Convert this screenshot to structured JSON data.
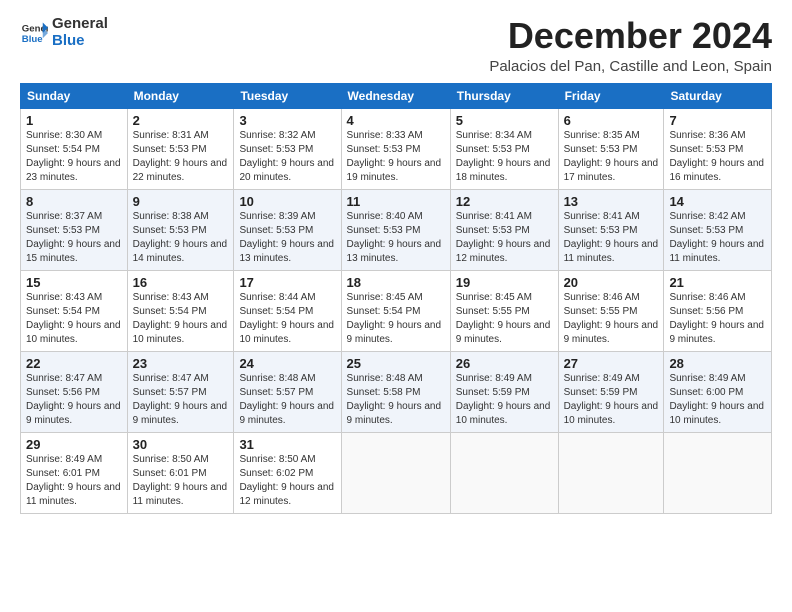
{
  "logo": {
    "line1": "General",
    "line2": "Blue"
  },
  "title": "December 2024",
  "subtitle": "Palacios del Pan, Castille and Leon, Spain",
  "weekdays": [
    "Sunday",
    "Monday",
    "Tuesday",
    "Wednesday",
    "Thursday",
    "Friday",
    "Saturday"
  ],
  "weeks": [
    [
      {
        "day": "1",
        "sunrise": "Sunrise: 8:30 AM",
        "sunset": "Sunset: 5:54 PM",
        "daylight": "Daylight: 9 hours and 23 minutes."
      },
      {
        "day": "2",
        "sunrise": "Sunrise: 8:31 AM",
        "sunset": "Sunset: 5:53 PM",
        "daylight": "Daylight: 9 hours and 22 minutes."
      },
      {
        "day": "3",
        "sunrise": "Sunrise: 8:32 AM",
        "sunset": "Sunset: 5:53 PM",
        "daylight": "Daylight: 9 hours and 20 minutes."
      },
      {
        "day": "4",
        "sunrise": "Sunrise: 8:33 AM",
        "sunset": "Sunset: 5:53 PM",
        "daylight": "Daylight: 9 hours and 19 minutes."
      },
      {
        "day": "5",
        "sunrise": "Sunrise: 8:34 AM",
        "sunset": "Sunset: 5:53 PM",
        "daylight": "Daylight: 9 hours and 18 minutes."
      },
      {
        "day": "6",
        "sunrise": "Sunrise: 8:35 AM",
        "sunset": "Sunset: 5:53 PM",
        "daylight": "Daylight: 9 hours and 17 minutes."
      },
      {
        "day": "7",
        "sunrise": "Sunrise: 8:36 AM",
        "sunset": "Sunset: 5:53 PM",
        "daylight": "Daylight: 9 hours and 16 minutes."
      }
    ],
    [
      {
        "day": "8",
        "sunrise": "Sunrise: 8:37 AM",
        "sunset": "Sunset: 5:53 PM",
        "daylight": "Daylight: 9 hours and 15 minutes."
      },
      {
        "day": "9",
        "sunrise": "Sunrise: 8:38 AM",
        "sunset": "Sunset: 5:53 PM",
        "daylight": "Daylight: 9 hours and 14 minutes."
      },
      {
        "day": "10",
        "sunrise": "Sunrise: 8:39 AM",
        "sunset": "Sunset: 5:53 PM",
        "daylight": "Daylight: 9 hours and 13 minutes."
      },
      {
        "day": "11",
        "sunrise": "Sunrise: 8:40 AM",
        "sunset": "Sunset: 5:53 PM",
        "daylight": "Daylight: 9 hours and 13 minutes."
      },
      {
        "day": "12",
        "sunrise": "Sunrise: 8:41 AM",
        "sunset": "Sunset: 5:53 PM",
        "daylight": "Daylight: 9 hours and 12 minutes."
      },
      {
        "day": "13",
        "sunrise": "Sunrise: 8:41 AM",
        "sunset": "Sunset: 5:53 PM",
        "daylight": "Daylight: 9 hours and 11 minutes."
      },
      {
        "day": "14",
        "sunrise": "Sunrise: 8:42 AM",
        "sunset": "Sunset: 5:53 PM",
        "daylight": "Daylight: 9 hours and 11 minutes."
      }
    ],
    [
      {
        "day": "15",
        "sunrise": "Sunrise: 8:43 AM",
        "sunset": "Sunset: 5:54 PM",
        "daylight": "Daylight: 9 hours and 10 minutes."
      },
      {
        "day": "16",
        "sunrise": "Sunrise: 8:43 AM",
        "sunset": "Sunset: 5:54 PM",
        "daylight": "Daylight: 9 hours and 10 minutes."
      },
      {
        "day": "17",
        "sunrise": "Sunrise: 8:44 AM",
        "sunset": "Sunset: 5:54 PM",
        "daylight": "Daylight: 9 hours and 10 minutes."
      },
      {
        "day": "18",
        "sunrise": "Sunrise: 8:45 AM",
        "sunset": "Sunset: 5:54 PM",
        "daylight": "Daylight: 9 hours and 9 minutes."
      },
      {
        "day": "19",
        "sunrise": "Sunrise: 8:45 AM",
        "sunset": "Sunset: 5:55 PM",
        "daylight": "Daylight: 9 hours and 9 minutes."
      },
      {
        "day": "20",
        "sunrise": "Sunrise: 8:46 AM",
        "sunset": "Sunset: 5:55 PM",
        "daylight": "Daylight: 9 hours and 9 minutes."
      },
      {
        "day": "21",
        "sunrise": "Sunrise: 8:46 AM",
        "sunset": "Sunset: 5:56 PM",
        "daylight": "Daylight: 9 hours and 9 minutes."
      }
    ],
    [
      {
        "day": "22",
        "sunrise": "Sunrise: 8:47 AM",
        "sunset": "Sunset: 5:56 PM",
        "daylight": "Daylight: 9 hours and 9 minutes."
      },
      {
        "day": "23",
        "sunrise": "Sunrise: 8:47 AM",
        "sunset": "Sunset: 5:57 PM",
        "daylight": "Daylight: 9 hours and 9 minutes."
      },
      {
        "day": "24",
        "sunrise": "Sunrise: 8:48 AM",
        "sunset": "Sunset: 5:57 PM",
        "daylight": "Daylight: 9 hours and 9 minutes."
      },
      {
        "day": "25",
        "sunrise": "Sunrise: 8:48 AM",
        "sunset": "Sunset: 5:58 PM",
        "daylight": "Daylight: 9 hours and 9 minutes."
      },
      {
        "day": "26",
        "sunrise": "Sunrise: 8:49 AM",
        "sunset": "Sunset: 5:59 PM",
        "daylight": "Daylight: 9 hours and 10 minutes."
      },
      {
        "day": "27",
        "sunrise": "Sunrise: 8:49 AM",
        "sunset": "Sunset: 5:59 PM",
        "daylight": "Daylight: 9 hours and 10 minutes."
      },
      {
        "day": "28",
        "sunrise": "Sunrise: 8:49 AM",
        "sunset": "Sunset: 6:00 PM",
        "daylight": "Daylight: 9 hours and 10 minutes."
      }
    ],
    [
      {
        "day": "29",
        "sunrise": "Sunrise: 8:49 AM",
        "sunset": "Sunset: 6:01 PM",
        "daylight": "Daylight: 9 hours and 11 minutes."
      },
      {
        "day": "30",
        "sunrise": "Sunrise: 8:50 AM",
        "sunset": "Sunset: 6:01 PM",
        "daylight": "Daylight: 9 hours and 11 minutes."
      },
      {
        "day": "31",
        "sunrise": "Sunrise: 8:50 AM",
        "sunset": "Sunset: 6:02 PM",
        "daylight": "Daylight: 9 hours and 12 minutes."
      },
      null,
      null,
      null,
      null
    ]
  ]
}
